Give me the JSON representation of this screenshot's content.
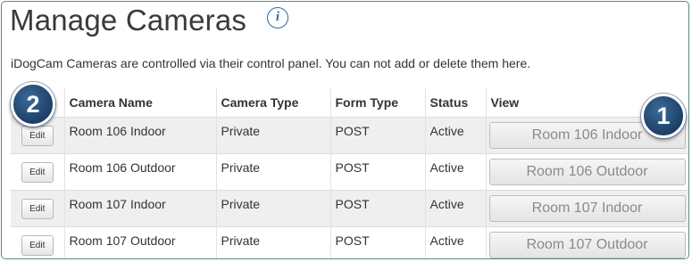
{
  "page": {
    "title": "Manage Cameras",
    "info_icon_glyph": "i",
    "intro": "iDogCam Cameras are controlled via their control panel. You can not add or delete them here."
  },
  "table": {
    "columns": [
      "",
      "Camera Name",
      "Camera Type",
      "Form Type",
      "Status",
      "View"
    ],
    "rows": [
      {
        "edit_label": "Edit",
        "camera_name": "Room 106 Indoor",
        "camera_type": "Private",
        "form_type": "POST",
        "status": "Active",
        "view_label": "Room 106 Indoor"
      },
      {
        "edit_label": "Edit",
        "camera_name": "Room 106 Outdoor",
        "camera_type": "Private",
        "form_type": "POST",
        "status": "Active",
        "view_label": "Room 106 Outdoor"
      },
      {
        "edit_label": "Edit",
        "camera_name": "Room 107 Indoor",
        "camera_type": "Private",
        "form_type": "POST",
        "status": "Active",
        "view_label": "Room 107 Indoor"
      },
      {
        "edit_label": "Edit",
        "camera_name": "Room 107 Outdoor",
        "camera_type": "Private",
        "form_type": "POST",
        "status": "Active",
        "view_label": "Room 107 Outdoor"
      }
    ]
  },
  "callouts": {
    "one": "1",
    "two": "2"
  },
  "colors": {
    "frame_border": "#5c8a8a",
    "callout": "#1d3f66",
    "info_icon": "#2a6aa8",
    "row_stripe": "#efefef"
  }
}
